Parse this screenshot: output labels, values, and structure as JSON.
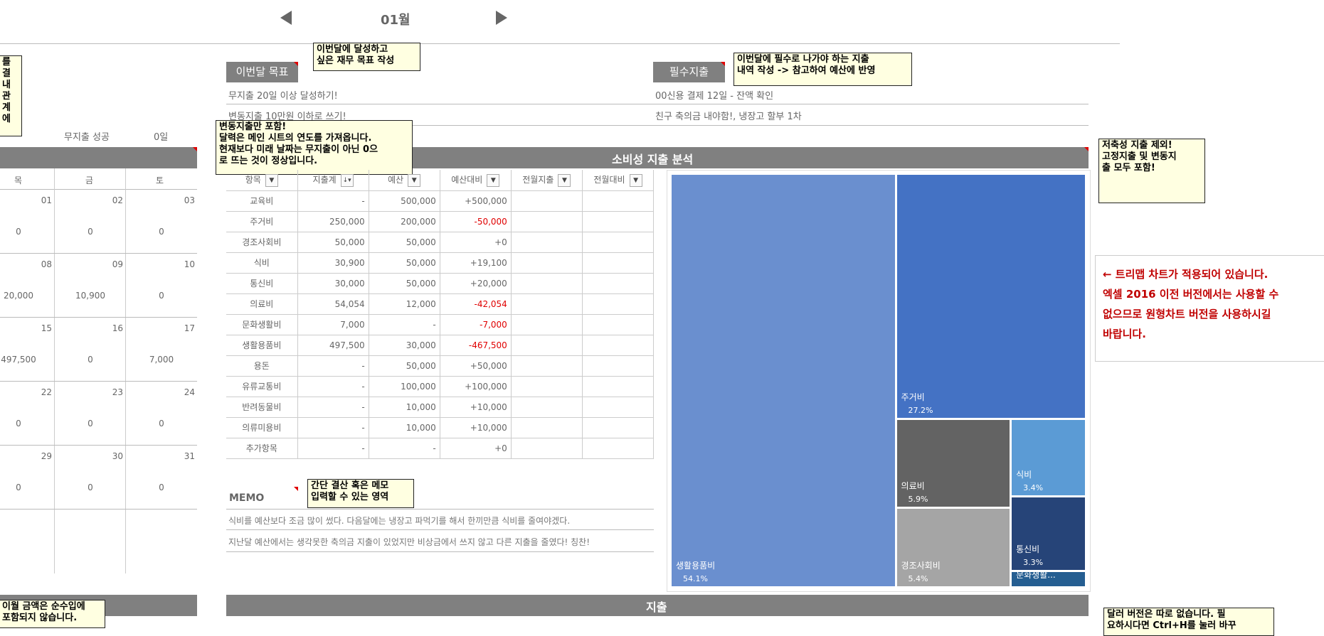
{
  "nav": {
    "month": "01월"
  },
  "calendar": {
    "no_spend_label": "무지출 성공",
    "no_spend_days": "0일",
    "headers": [
      "목",
      "금",
      "토"
    ],
    "weeks": [
      {
        "dates": [
          "01",
          "02",
          "03"
        ],
        "amounts": [
          "0",
          "0",
          "0"
        ]
      },
      {
        "dates": [
          "08",
          "09",
          "10"
        ],
        "amounts": [
          "20,000",
          "10,900",
          "0"
        ]
      },
      {
        "dates": [
          "15",
          "16",
          "17"
        ],
        "amounts": [
          "497,500",
          "0",
          "7,000"
        ]
      },
      {
        "dates": [
          "22",
          "23",
          "24"
        ],
        "amounts": [
          "0",
          "0",
          "0"
        ]
      },
      {
        "dates": [
          "29",
          "30",
          "31"
        ],
        "amounts": [
          "0",
          "0",
          "0"
        ]
      }
    ]
  },
  "goals": {
    "title": "이번달 목표",
    "items": [
      "무지출 20일 이상 달성하기!",
      "변동지출 10만원 이하로 쓰기!"
    ]
  },
  "essential": {
    "title": "필수지출",
    "items": [
      "00신용 결제 12일 - 잔액 확인",
      "친구 축의금 내야함!, 냉장고 할부 1차"
    ]
  },
  "analysis": {
    "title": "소비성 지출 분석"
  },
  "budget_table": {
    "headers": [
      "항목",
      "지출계",
      "예산",
      "예산대비",
      "전월지출",
      "전월대비"
    ],
    "rows": [
      {
        "item": "교육비",
        "spent": "-",
        "budget": "500,000",
        "diff": "+500,000",
        "neg": false
      },
      {
        "item": "주거비",
        "spent": "250,000",
        "budget": "200,000",
        "diff": "-50,000",
        "neg": true
      },
      {
        "item": "경조사회비",
        "spent": "50,000",
        "budget": "50,000",
        "diff": "+0",
        "neg": false
      },
      {
        "item": "식비",
        "spent": "30,900",
        "budget": "50,000",
        "diff": "+19,100",
        "neg": false
      },
      {
        "item": "통신비",
        "spent": "30,000",
        "budget": "50,000",
        "diff": "+20,000",
        "neg": false
      },
      {
        "item": "의료비",
        "spent": "54,054",
        "budget": "12,000",
        "diff": "-42,054",
        "neg": true
      },
      {
        "item": "문화생활비",
        "spent": "7,000",
        "budget": "-",
        "diff": "-7,000",
        "neg": true
      },
      {
        "item": "생활용품비",
        "spent": "497,500",
        "budget": "30,000",
        "diff": "-467,500",
        "neg": true
      },
      {
        "item": "용돈",
        "spent": "-",
        "budget": "50,000",
        "diff": "+50,000",
        "neg": false
      },
      {
        "item": "유류교통비",
        "spent": "-",
        "budget": "100,000",
        "diff": "+100,000",
        "neg": false
      },
      {
        "item": "반려동물비",
        "spent": "-",
        "budget": "10,000",
        "diff": "+10,000",
        "neg": false
      },
      {
        "item": "의류미용비",
        "spent": "-",
        "budget": "10,000",
        "diff": "+10,000",
        "neg": false
      },
      {
        "item": "추가항목",
        "spent": "-",
        "budget": "-",
        "diff": "+0",
        "neg": false
      }
    ]
  },
  "memo": {
    "title": "MEMO",
    "lines": [
      "식비를 예산보다 조금 많이 썼다. 다음달에는 냉장고 파먹기를 해서 한끼만큼 식비를 줄여야겠다.",
      "지난달 예산에서는 생각못한 축의금 지출이 있었지만 비상금에서 쓰지 않고 다른 지출을 줄였다! 칭찬!"
    ]
  },
  "expense_bar": {
    "title": "지출"
  },
  "chart_data": {
    "type": "treemap",
    "labels": [
      "생활용품비",
      "주거비",
      "의료비",
      "경조사회비",
      "식비",
      "통신비",
      "문화생활..."
    ],
    "percent_labels": [
      "54.1%",
      "27.2%",
      "5.9%",
      "5.4%",
      "3.4%",
      "3.3%",
      ""
    ],
    "values": [
      54.1,
      27.2,
      5.9,
      5.4,
      3.4,
      3.3,
      0.8
    ],
    "colors": [
      "#6a8fcf",
      "#4472c4",
      "#636363",
      "#a5a5a5",
      "#5b9bd5",
      "#264478",
      "#255e91"
    ]
  },
  "info": {
    "lines": [
      "← 트리맵 차트가 적용되어 있습니다.",
      "엑셀 2016 이전 버전에서는 사용할 수",
      "없으므로 원형차트 버전을 사용하시길",
      "바랍니다."
    ]
  },
  "comments": {
    "goal": "이번달에 달성하고\n싶은 재무 목표 작성",
    "essential": "이번달에 필수로 나가야 하는 지출\n내역 작성 -> 참고하여 예산에 반영",
    "variable": "변동지출만 포함!\n달력은 메인 시트의 연도를 가져옵니다.\n현재보다 미래 날짜는 무지출이 아닌 0으\n로 뜨는 것이 정상입니다.",
    "savings": "저축성 지출 제외!\n고정지출 및 변동지\n출 모두 포함!",
    "memo": "간단 결산 혹은 메모\n입력할 수 있는 영역",
    "left_top": "를\n결내\n관\n계\n에",
    "left_bottom": "이월 금액은 순수입에\n포함되지 않습니다.",
    "right_bottom": "달러 버전은 따로 없습니다. 필\n요하시다면 Ctrl+H를 눌러 바꾸"
  }
}
